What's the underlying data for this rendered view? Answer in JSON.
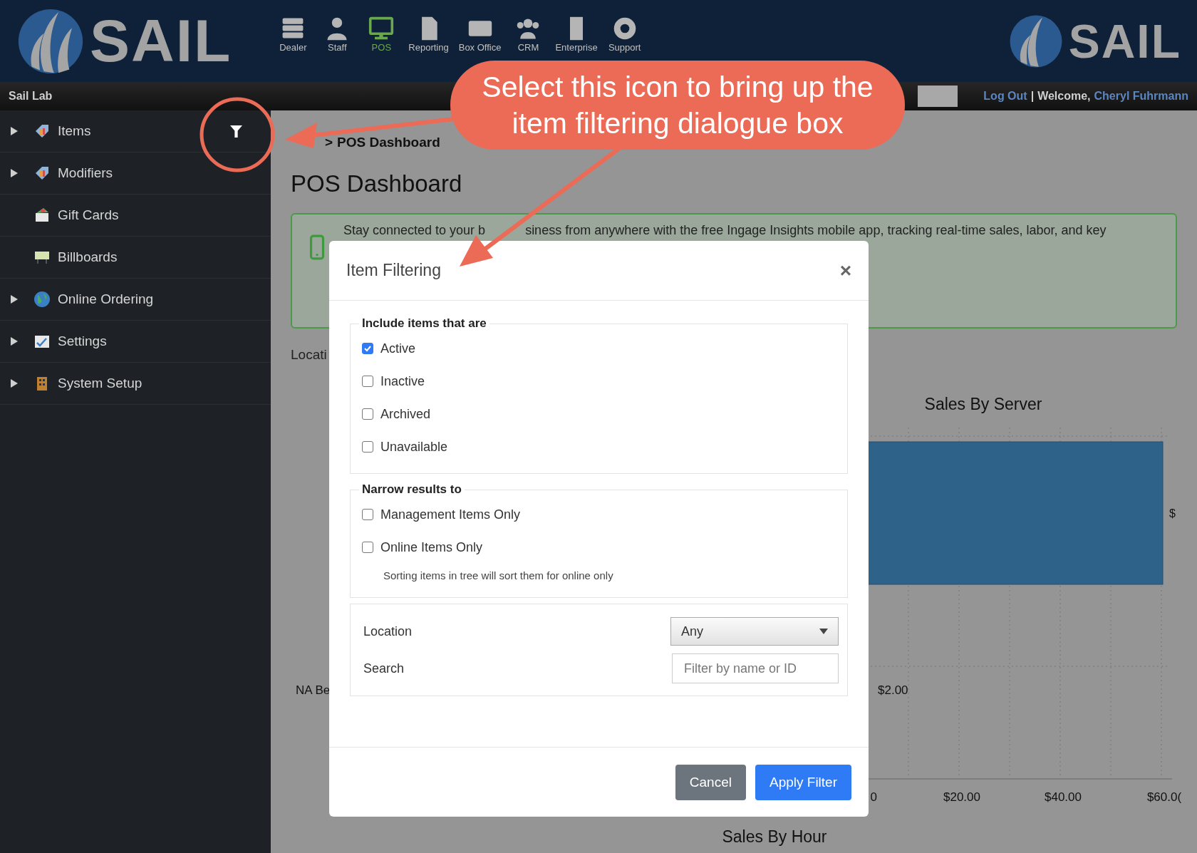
{
  "header": {
    "logo_text": "SAIL",
    "right_logo_text": "SAIL",
    "nav": [
      {
        "label": "Dealer",
        "kind": "server",
        "selected": false
      },
      {
        "label": "Staff",
        "kind": "person",
        "selected": false
      },
      {
        "label": "POS",
        "kind": "monitor",
        "selected": true
      },
      {
        "label": "Reporting",
        "kind": "document",
        "selected": false
      },
      {
        "label": "Box Office",
        "kind": "ticket",
        "selected": false
      },
      {
        "label": "CRM",
        "kind": "group",
        "selected": false
      },
      {
        "label": "Enterprise",
        "kind": "building",
        "selected": false
      },
      {
        "label": "Support",
        "kind": "lifebuoy",
        "selected": false
      }
    ]
  },
  "subbar": {
    "site": "Sail Lab",
    "logout": "Log Out",
    "separator": "|",
    "welcome": "Welcome,",
    "user": "Cheryl Fuhrmann"
  },
  "sidebar": {
    "items": [
      {
        "label": "Items",
        "kind": "tag",
        "expandable": true,
        "filter": true
      },
      {
        "label": "Modifiers",
        "kind": "tag",
        "expandable": true,
        "filter": false
      },
      {
        "label": "Gift Cards",
        "kind": "gift",
        "expandable": false,
        "filter": false
      },
      {
        "label": "Billboards",
        "kind": "billboard",
        "expandable": false,
        "filter": false
      },
      {
        "label": "Online Ordering",
        "kind": "globe",
        "expandable": true,
        "filter": false
      },
      {
        "label": "Settings",
        "kind": "checklist",
        "expandable": true,
        "filter": false
      },
      {
        "label": "System Setup",
        "kind": "building",
        "expandable": true,
        "filter": false
      }
    ]
  },
  "breadcrumb": {
    "separator": ">",
    "current": "POS Dashboard"
  },
  "page_title": "POS Dashboard",
  "alert": {
    "text_start": "Stay connected to your b",
    "text_end": "siness from anywhere with the free Ingage Insights mobile app, tracking real-time sales, labor, and key"
  },
  "location_label": "Locati",
  "chart": {
    "title": "Sales By Server",
    "bar_value": "$",
    "row_label": "NA Be",
    "row_value": "$2.00",
    "ticks": [
      "0",
      "$20.00",
      "$40.00",
      "$60.0("
    ],
    "next_title": "Sales By Hour"
  },
  "modal": {
    "title": "Item Filtering",
    "close": "×",
    "include": {
      "legend": "Include items that are",
      "options": [
        {
          "label": "Active",
          "checked": true
        },
        {
          "label": "Inactive",
          "checked": false
        },
        {
          "label": "Archived",
          "checked": false
        },
        {
          "label": "Unavailable",
          "checked": false
        }
      ]
    },
    "narrow": {
      "legend": "Narrow results to",
      "options": [
        {
          "label": "Management Items Only",
          "checked": false
        },
        {
          "label": "Online Items Only",
          "checked": false
        }
      ],
      "note": "Sorting items in tree will sort them for online only"
    },
    "location": {
      "label": "Location",
      "value": "Any"
    },
    "search": {
      "label": "Search",
      "placeholder": "Filter by name or ID"
    },
    "buttons": [
      {
        "label": "Cancel",
        "kind": "secondary"
      },
      {
        "label": "Apply Filter",
        "kind": "primary"
      }
    ]
  },
  "callout": {
    "text": "Select this icon to bring up the item filtering dialogue box"
  }
}
